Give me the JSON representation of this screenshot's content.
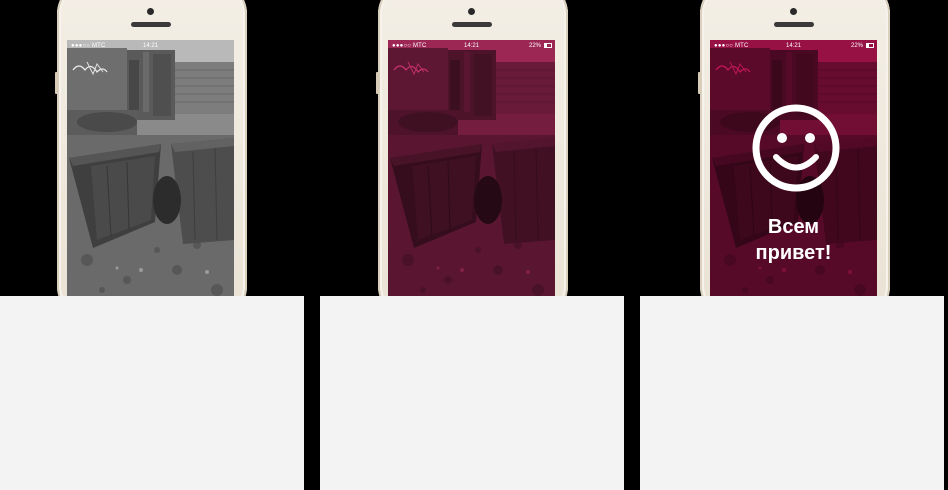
{
  "phones": [
    {
      "label": "phone-original",
      "status": {
        "carrier": "●●●○○ МТС",
        "time": "14:21",
        "battery": ""
      },
      "tinted": false
    },
    {
      "label": "phone-tinted",
      "status": {
        "carrier": "●●●○○ МТС",
        "time": "14:21",
        "battery": "22%"
      },
      "tinted": true
    },
    {
      "label": "phone-greeting",
      "status": {
        "carrier": "●●●○○ МТС",
        "time": "14:21",
        "battery": "22%"
      },
      "tinted": true,
      "greeting": {
        "line1": "Всем",
        "line2": "привет!"
      },
      "icon": "smiley-face-icon"
    }
  ],
  "colors": {
    "tint": "#d2175f",
    "background": "#000000",
    "card": "#f3f3f3",
    "phone_body": "#ede6d9"
  }
}
